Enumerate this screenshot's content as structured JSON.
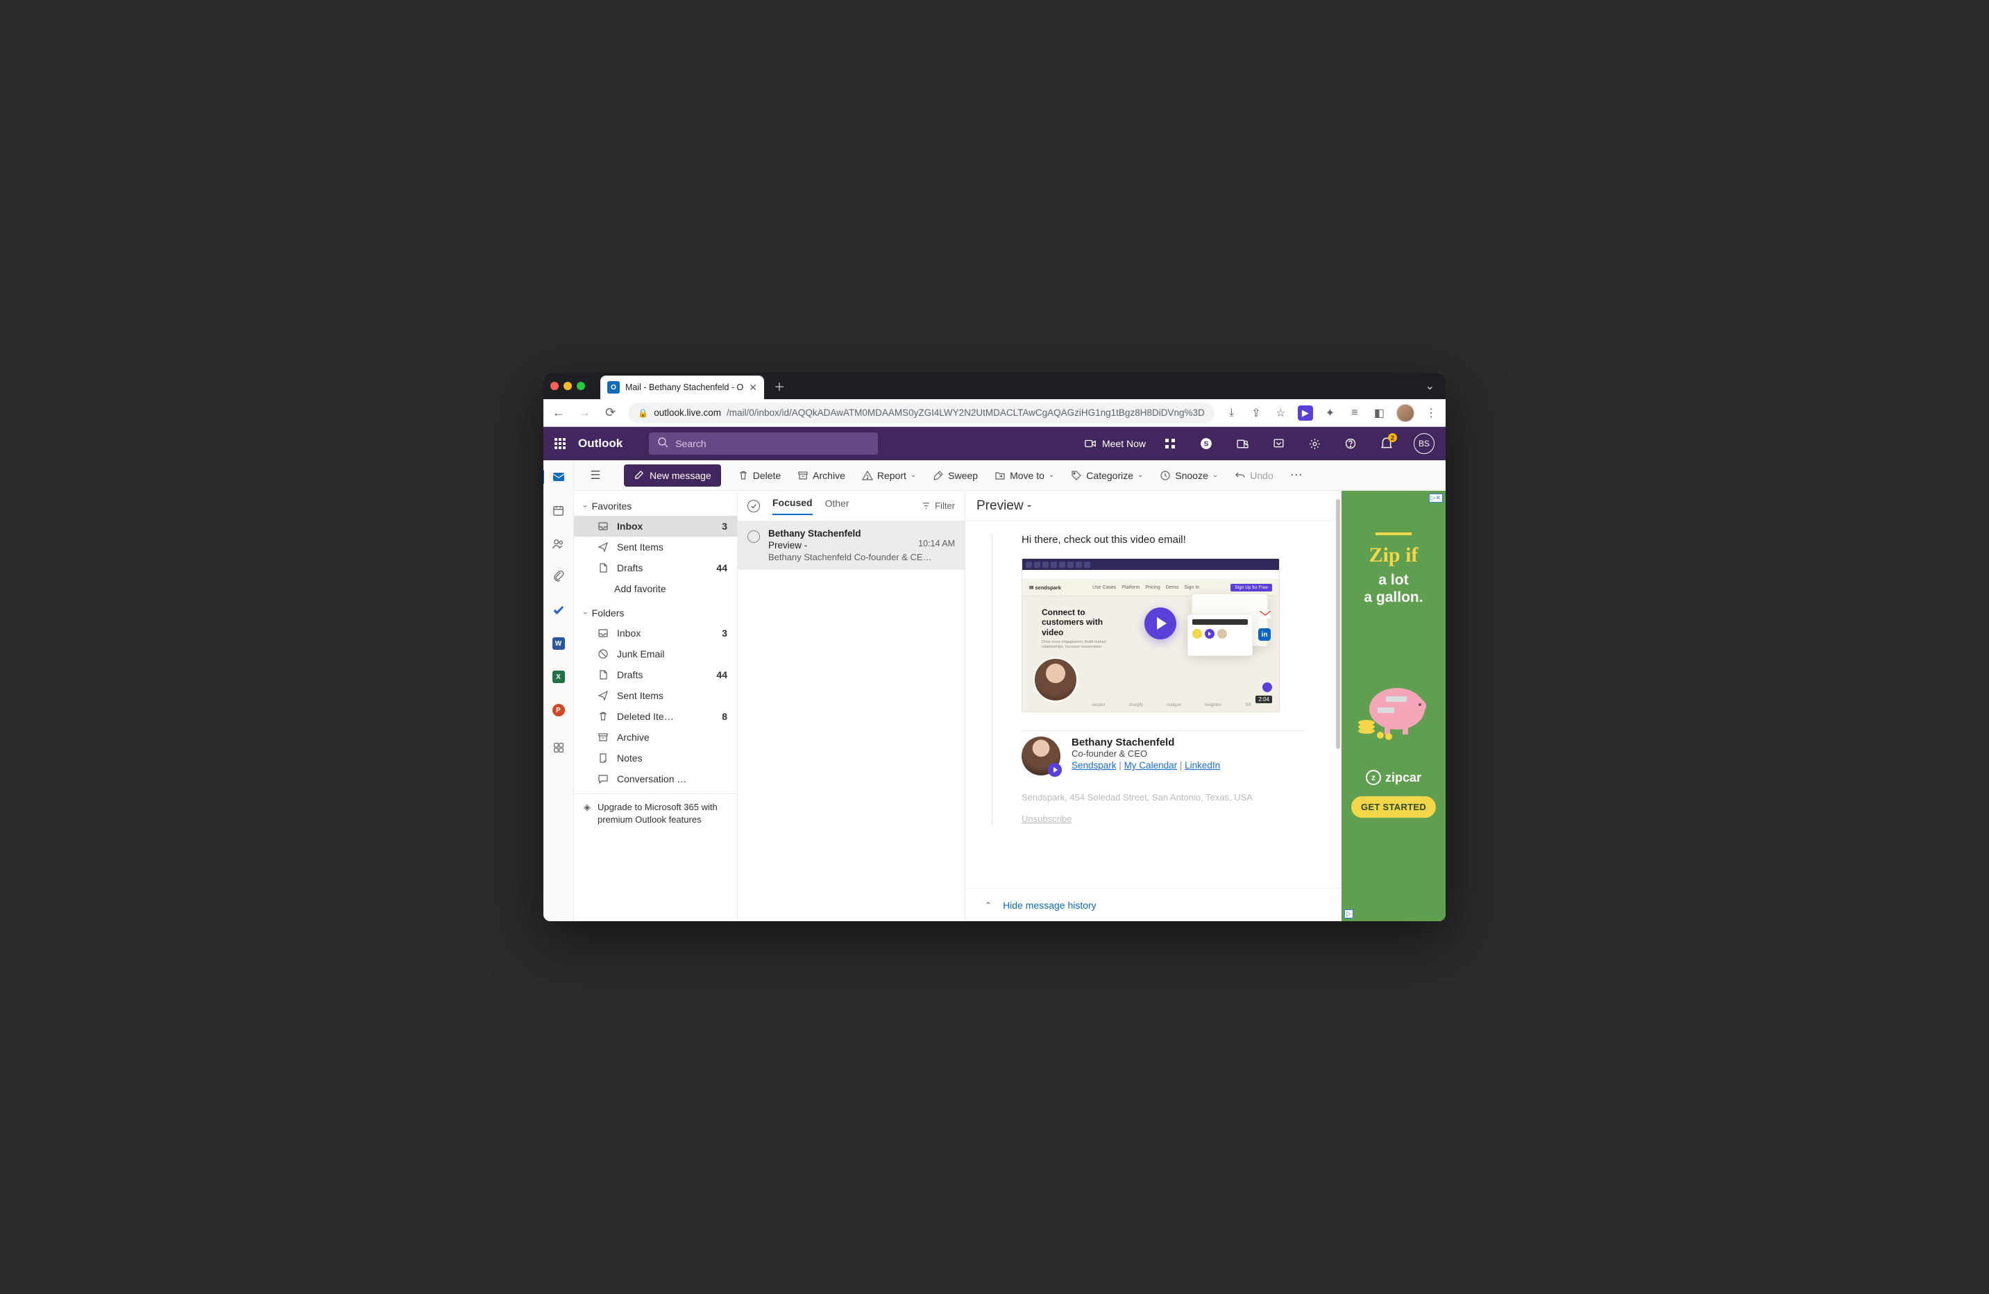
{
  "browser": {
    "tab_title": "Mail - Bethany Stachenfeld - O",
    "url_host": "outlook.live.com",
    "url_path": "/mail/0/inbox/id/AQQkADAwATM0MDAAMS0yZGI4LWY2N2UtMDACLTAwCgAQAGziHG1ng1tBgz8H8DiDVng%3D"
  },
  "header": {
    "brand": "Outlook",
    "search_placeholder": "Search",
    "meet_now": "Meet Now",
    "notify_count": "2",
    "avatar_initials": "BS"
  },
  "toolbar": {
    "new_message": "New message",
    "delete": "Delete",
    "archive": "Archive",
    "report": "Report",
    "sweep": "Sweep",
    "move_to": "Move to",
    "categorize": "Categorize",
    "snooze": "Snooze",
    "undo": "Undo"
  },
  "nav": {
    "favorites_label": "Favorites",
    "folders_label": "Folders",
    "add_favorite": "Add favorite",
    "favorites": [
      {
        "icon": "inbox",
        "label": "Inbox",
        "count": "3",
        "selected": true
      },
      {
        "icon": "send",
        "label": "Sent Items"
      },
      {
        "icon": "draft",
        "label": "Drafts",
        "count": "44"
      }
    ],
    "folders": [
      {
        "icon": "inbox",
        "label": "Inbox",
        "count": "3"
      },
      {
        "icon": "junk",
        "label": "Junk Email"
      },
      {
        "icon": "draft",
        "label": "Drafts",
        "count": "44"
      },
      {
        "icon": "send",
        "label": "Sent Items"
      },
      {
        "icon": "trash",
        "label": "Deleted Ite…",
        "count": "8"
      },
      {
        "icon": "archive",
        "label": "Archive"
      },
      {
        "icon": "note",
        "label": "Notes"
      },
      {
        "icon": "chat",
        "label": "Conversation …"
      }
    ],
    "upgrade": "Upgrade to Microsoft 365 with premium Outlook features"
  },
  "msglist": {
    "tab_focused": "Focused",
    "tab_other": "Other",
    "filter": "Filter",
    "items": [
      {
        "from": "Bethany Stachenfeld",
        "subject": "Preview -",
        "time": "10:14 AM",
        "preview": "Bethany Stachenfeld Co-founder & CE…"
      }
    ]
  },
  "reading": {
    "subject": "Preview -",
    "greeting": "Hi there, check out this video email!",
    "video": {
      "brand": "sendspark",
      "nav": [
        "Use Cases",
        "Platform",
        "Pricing",
        "Demo",
        "Sign In"
      ],
      "cta": "Sign Up for Free",
      "headline1": "Connect to",
      "headline2": "customers with",
      "headline3": "video",
      "sub": "Drive more engagement. Build human relationships. Increase conversions.",
      "duration": "2:04",
      "logos": [
        "serpilot",
        "chargify",
        "mailgun",
        "Neighbor",
        "Sift"
      ]
    },
    "signature": {
      "name": "Bethany Stachenfeld",
      "title": "Co-founder & CEO",
      "link1": "Sendspark",
      "link2": "My Calendar",
      "link3": "LinkedIn",
      "sep": " | ",
      "address": "Sendspark, 454 Soledad Street, San Antonio, Texas, USA",
      "unsubscribe": "Unsubscribe"
    },
    "hide_history": "Hide message history"
  },
  "ad": {
    "headline": "Zip if",
    "sub1": "a lot",
    "sub2": "a gallon.",
    "brand": "zipcar",
    "cta": "GET STARTED"
  }
}
